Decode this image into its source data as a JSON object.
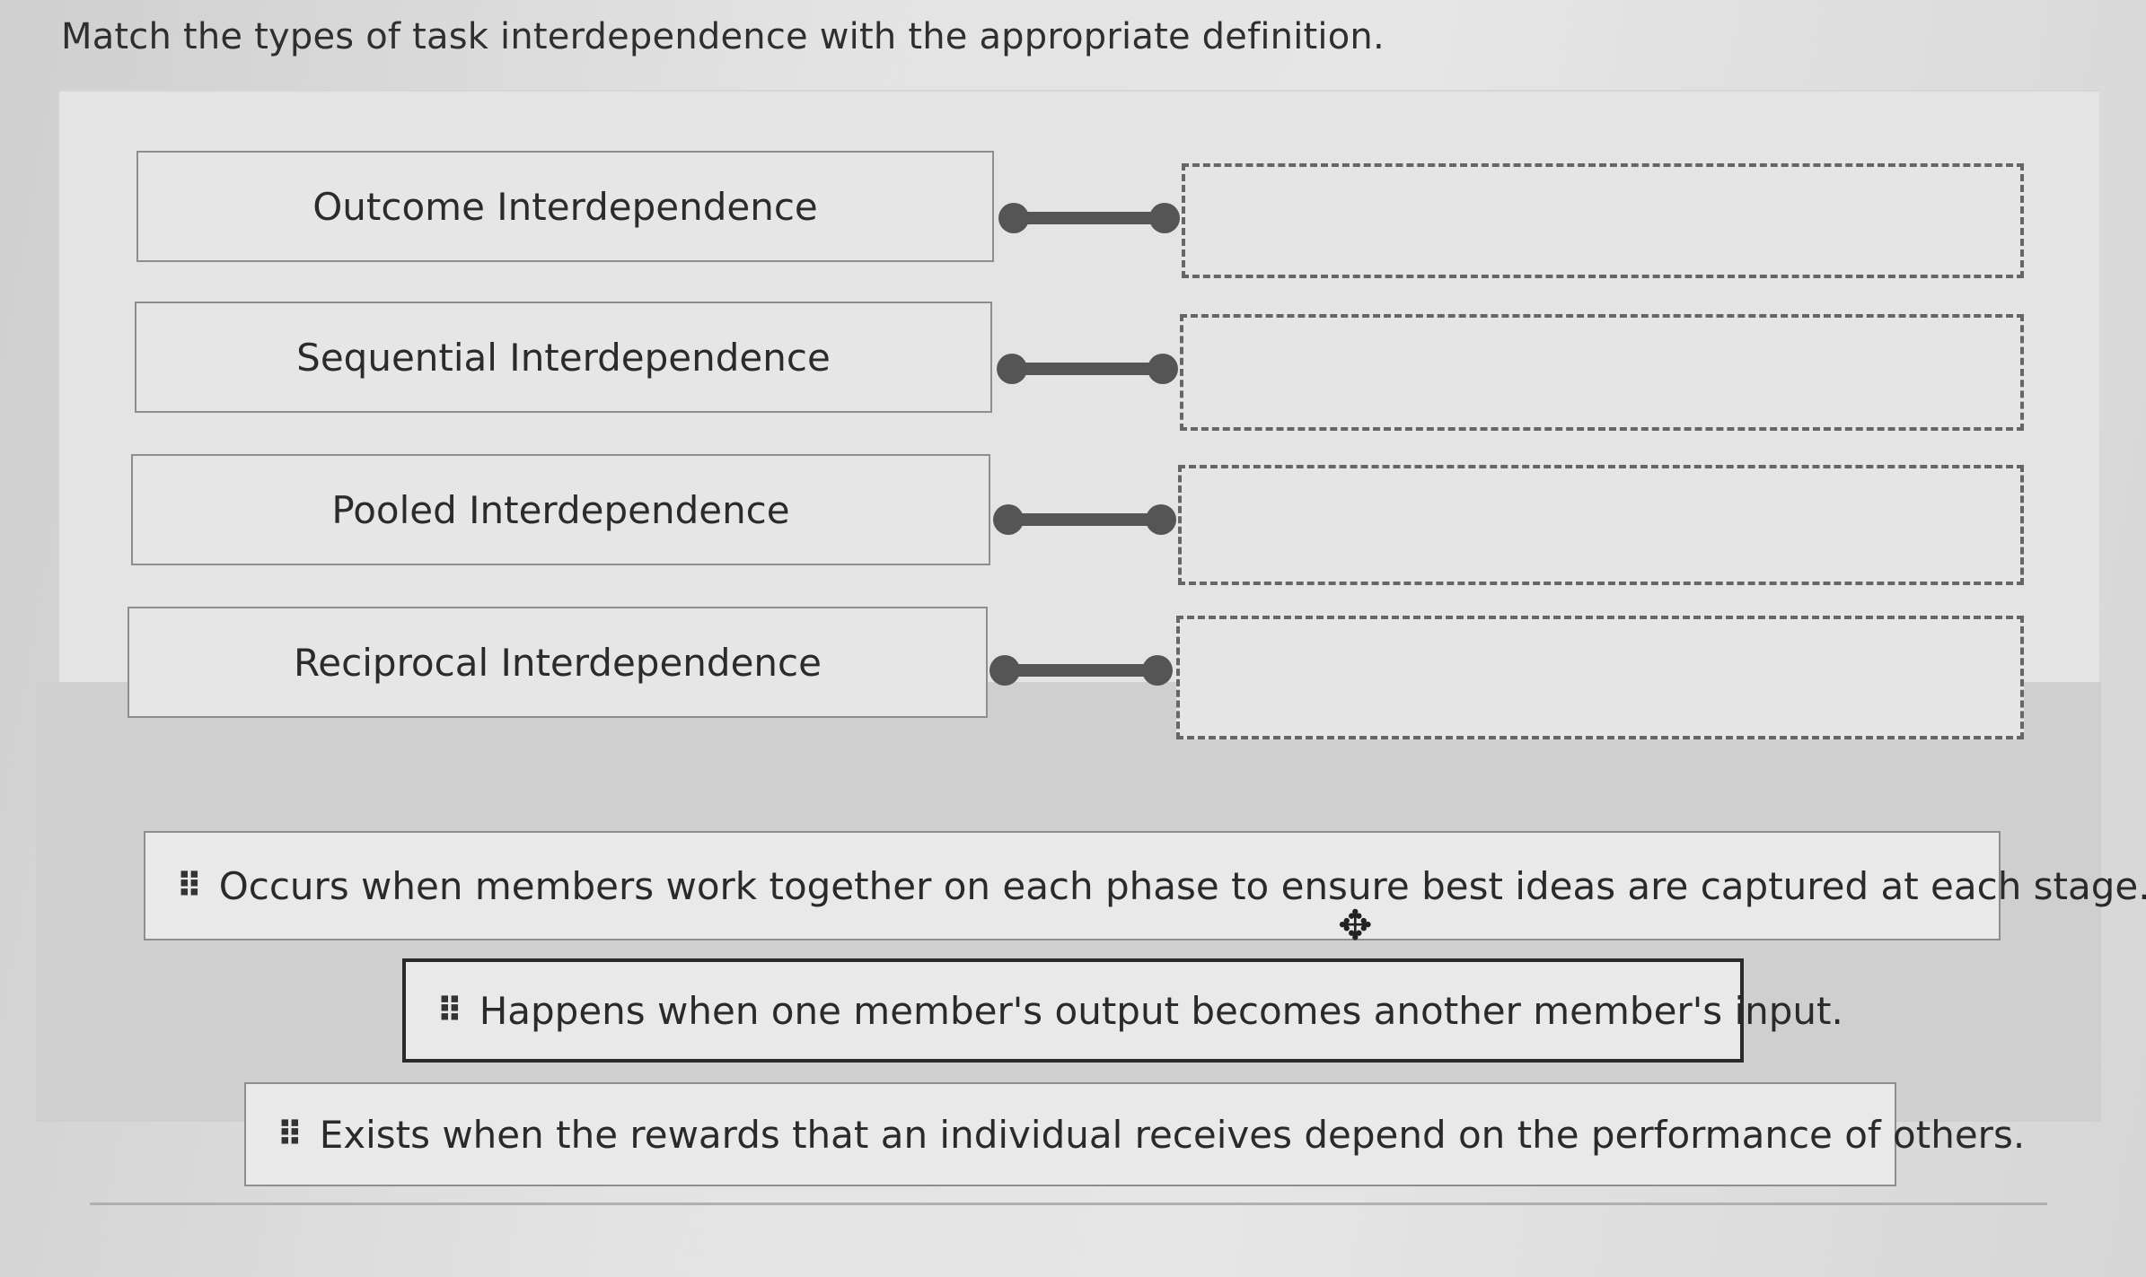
{
  "prompt": "Match the types of task interdependence with the appropriate definition.",
  "terms": [
    "Outcome Interdependence",
    "Sequential Interdependence",
    "Pooled Interdependence",
    "Reciprocal Interdependence"
  ],
  "definitions": [
    "Occurs when members work together on each phase to ensure best ideas are captured at each stage.",
    "Happens when one member's output becomes another member's input.",
    "Exists when the rewards that an individual receives depend on the performance of others."
  ],
  "icons": {
    "drag_handle": "grip-icon",
    "cursor": "move-cursor-icon"
  }
}
